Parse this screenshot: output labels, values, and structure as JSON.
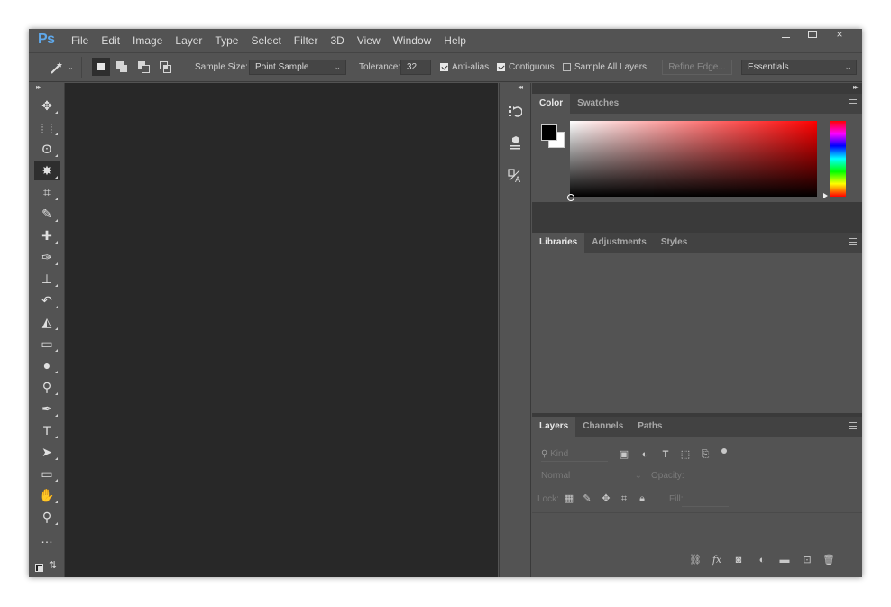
{
  "app": {
    "logo": "Ps"
  },
  "menu": [
    "File",
    "Edit",
    "Image",
    "Layer",
    "Type",
    "Select",
    "Filter",
    "3D",
    "View",
    "Window",
    "Help"
  ],
  "window_controls": {
    "close": "×"
  },
  "options_bar": {
    "sample_size_label": "Sample Size:",
    "sample_size_value": "Point Sample",
    "tolerance_label": "Tolerance:",
    "tolerance_value": "32",
    "anti_alias_label": "Anti-alias",
    "anti_alias_checked": true,
    "contiguous_label": "Contiguous",
    "contiguous_checked": true,
    "sample_all_layers_label": "Sample All Layers",
    "sample_all_layers_checked": false,
    "refine_edge_label": "Refine Edge...",
    "workspace_value": "Essentials"
  },
  "tools": [
    {
      "name": "move-tool-icon",
      "glyph": "✥"
    },
    {
      "name": "rectangular-marquee-icon",
      "glyph": "⬚"
    },
    {
      "name": "lasso-icon",
      "glyph": "ʘ"
    },
    {
      "name": "magic-wand-icon",
      "glyph": "✸",
      "active": true
    },
    {
      "name": "crop-icon",
      "glyph": "⌗"
    },
    {
      "name": "eyedropper-icon",
      "glyph": "✎"
    },
    {
      "name": "healing-brush-icon",
      "glyph": "✚"
    },
    {
      "name": "brush-icon",
      "glyph": "✑"
    },
    {
      "name": "clone-stamp-icon",
      "glyph": "⊥"
    },
    {
      "name": "history-brush-icon",
      "glyph": "↶"
    },
    {
      "name": "eraser-icon",
      "glyph": "◭"
    },
    {
      "name": "gradient-icon",
      "glyph": "▭"
    },
    {
      "name": "blur-icon",
      "glyph": "●"
    },
    {
      "name": "dodge-icon",
      "glyph": "⚲"
    },
    {
      "name": "pen-icon",
      "glyph": "✒"
    },
    {
      "name": "type-icon",
      "glyph": "T"
    },
    {
      "name": "path-selection-icon",
      "glyph": "➤"
    },
    {
      "name": "rectangle-shape-icon",
      "glyph": "▭"
    },
    {
      "name": "hand-icon",
      "glyph": "✋"
    },
    {
      "name": "zoom-icon",
      "glyph": "⚲"
    },
    {
      "name": "more-tools-icon",
      "glyph": "…"
    }
  ],
  "color_panel": {
    "tabs": [
      {
        "label": "Color",
        "active": true
      },
      {
        "label": "Swatches"
      }
    ],
    "foreground": "#000000",
    "background": "#ffffff",
    "hue": "#ff0000"
  },
  "libraries_panel": {
    "tabs": [
      {
        "label": "Libraries",
        "active": true
      },
      {
        "label": "Adjustments"
      },
      {
        "label": "Styles"
      }
    ]
  },
  "layers_panel": {
    "tabs": [
      {
        "label": "Layers",
        "active": true
      },
      {
        "label": "Channels"
      },
      {
        "label": "Paths"
      }
    ],
    "filter_placeholder": "Kind",
    "blend_mode": "Normal",
    "opacity_label": "Opacity:",
    "lock_label": "Lock:",
    "fill_label": "Fill:"
  }
}
